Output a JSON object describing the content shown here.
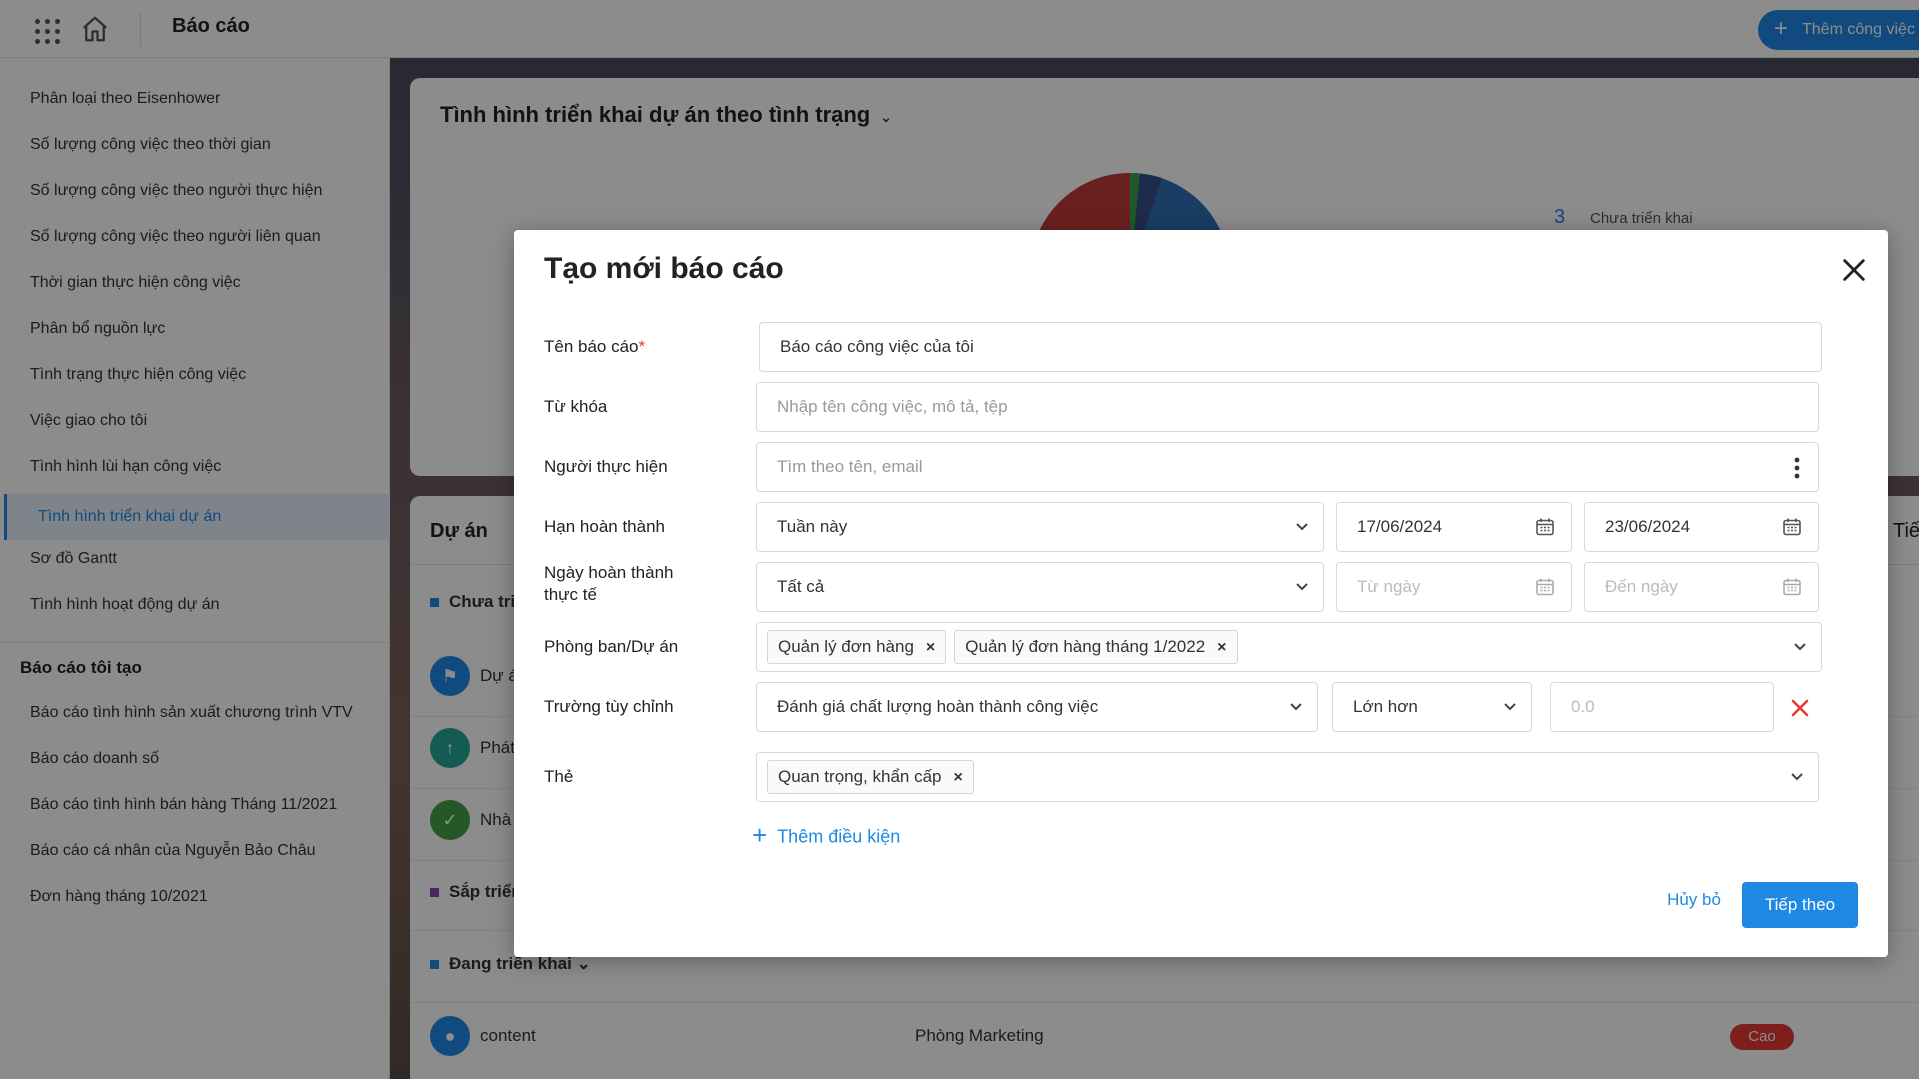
{
  "topbar": {
    "title": "Báo cáo",
    "add_button": "Thêm công việc"
  },
  "sidebar": {
    "items": [
      "Phân loại theo Eisenhower",
      "Số lượng công việc theo thời gian",
      "Số lượng công việc theo người thực hiện",
      "Số lượng công việc theo người liên quan",
      "Thời gian thực hiện công việc",
      "Phân bổ nguồn lực",
      "Tình trạng thực hiện công việc",
      "Việc giao cho tôi",
      "Tình hình lùi hạn công việc",
      "Tình hình triển khai dự án",
      "Sơ đồ Gantt",
      "Tình hình hoạt động dự án"
    ],
    "section_title": "Báo cáo tôi tạo",
    "my_reports": [
      "Báo cáo tình hình sản xuất chương trình VTV",
      "Báo cáo doanh số",
      "Báo cáo tình hình bán hàng Tháng 11/2021",
      "Báo cáo cá nhân của Nguyễn Bảo Châu",
      "Đơn hàng tháng 10/2021"
    ]
  },
  "chart_card": {
    "title": "Tình hình triển khai dự án theo tình trạng",
    "legend_value": "3",
    "legend_label": "Chưa triển khai"
  },
  "list_card": {
    "header": "Dự án",
    "header_right": "Tiế",
    "group1": "Chưa tri",
    "rows": [
      "Dự á",
      "Phát",
      "Nhà"
    ],
    "group2": "Sắp triển",
    "group3": "Đang triển khai",
    "content_row": {
      "name": "content",
      "dept": "Phòng Marketing",
      "priority": "Cao"
    }
  },
  "modal": {
    "title": "Tạo mới báo cáo",
    "labels": {
      "name": "Tên báo cáo",
      "required_mark": "*",
      "keyword": "Từ khóa",
      "assignee": "Người thực hiện",
      "deadline": "Hạn hoàn thành",
      "actual_done_1": "Ngày hoàn thành",
      "actual_done_2": "thực tế",
      "department": "Phòng ban/Dự án",
      "custom_field": "Trường tùy chỉnh",
      "tag": "Thẻ"
    },
    "name_value": "Báo cáo công việc của tôi",
    "keyword_placeholder": "Nhập tên công việc, mô tả, tệp",
    "assignee_placeholder": "Tìm theo tên, email",
    "deadline_select": "Tuần này",
    "deadline_from": "17/06/2024",
    "deadline_to": "23/06/2024",
    "actual_select": "Tất cả",
    "actual_from_placeholder": "Từ ngày",
    "actual_to_placeholder": "Đến ngày",
    "department_tags": [
      "Quản lý đơn hàng",
      "Quản lý đơn hàng tháng 1/2022"
    ],
    "custom_field_select": "Đánh giá chất lượng hoàn thành công việc",
    "operator_select": "Lớn hơn",
    "value_placeholder": "0.0",
    "tags": [
      "Quan trọng, khẩn cấp"
    ],
    "add_condition": "Thêm điều kiện",
    "cancel": "Hủy bỏ",
    "next": "Tiếp theo"
  },
  "colors": {
    "accent": "#1e88e5",
    "danger": "#e53935"
  }
}
